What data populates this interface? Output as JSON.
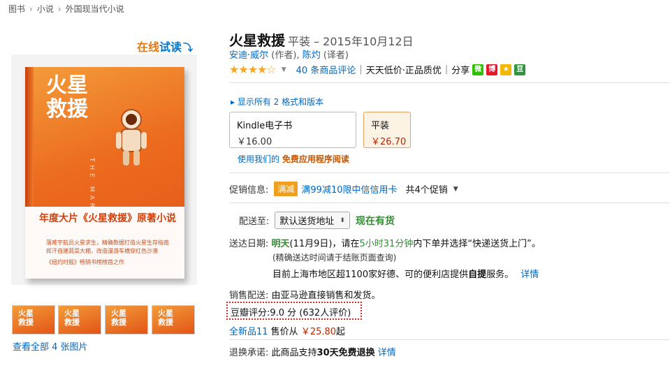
{
  "breadcrumb": [
    "图书",
    "小说",
    "外国现当代小说"
  ],
  "read_online": {
    "prefix": "在线",
    "highlight": "试读",
    "arrow": "⤵"
  },
  "book_cover": {
    "title_line1": "火星",
    "title_line2": "救援",
    "english": "THE MARTIAN",
    "band_headline": "年度大片《火星救援》原著小说",
    "band_line1": "落难宇航员火星求生，精确数据打造火星生存指南",
    "band_line2": "挥汗自建蔬菜大棚，改造漫游车横穿红色沙漠",
    "band_line3": "《纽约时报》畅销书榜榜首之作"
  },
  "thumbnails": [
    "火星救援",
    "火星救援",
    "火星救援",
    "火星救援"
  ],
  "view_all_images": "查看全部 4 张图片",
  "product": {
    "title": "火星救援",
    "binding_date": "平装 – 2015年10月12日",
    "author": "安迪·威尔",
    "author_role": "(作者),",
    "translator": "陈灼",
    "translator_role": "(译者)"
  },
  "rating": {
    "stars": "★★★★☆",
    "reviews_link": "40 条商品评论",
    "tagline": "天天低价·正品质优",
    "share_label": "分享",
    "share_icons": [
      {
        "name": "wechat-icon",
        "glyph": "微",
        "color": "#2dc100"
      },
      {
        "name": "weibo-icon",
        "glyph": "博",
        "color": "#e6162d"
      },
      {
        "name": "qzone-icon",
        "glyph": "★",
        "color": "#f5b800"
      },
      {
        "name": "douban-icon",
        "glyph": "豆",
        "color": "#2e963d"
      }
    ]
  },
  "formats": {
    "link": "▸ 显示所有 2 格式和版本",
    "options": [
      {
        "name": "Kindle电子书",
        "price": "￥16.00",
        "selected": false
      },
      {
        "name": "平装",
        "price": "￥26.70",
        "selected": true
      }
    ],
    "free_app_prefix": "使用我们的",
    "free_app_bold": "免费应用程序阅读"
  },
  "promotion": {
    "label": "促销信息:",
    "badge": "满减",
    "text": "满99减10限中信信用卡",
    "count": "共4个促销"
  },
  "delivery": {
    "label": "配送至:",
    "address": "默认送货地址",
    "stock": "现在有货",
    "date_label": "送达日期:",
    "date_green": "明天",
    "date_rest": "(11月9日)，请在",
    "countdown": "5小时31分钟",
    "date_tail": "内下单并选择“快递送货上门”。",
    "note1": "(精确送达时间请于结账页面查询)",
    "note2_prefix": "目前上海市地区超1100家好德、可的便利店提供",
    "note2_bold": "自提",
    "note2_suffix": "服务。",
    "details_link": "详情"
  },
  "seller": {
    "label": "销售配送:",
    "text": "由亚马逊直接销售和发货。"
  },
  "douban": {
    "text": "豆瓣评分:9.0 分 (632人评价)"
  },
  "used": {
    "link": "全新品11",
    "text": " 售价从 ",
    "price": "￥25.80",
    "tail": "起"
  },
  "returns": {
    "label": "退换承诺:",
    "text": "此商品支持",
    "bold": "30天免费退换",
    "link": "详情"
  }
}
